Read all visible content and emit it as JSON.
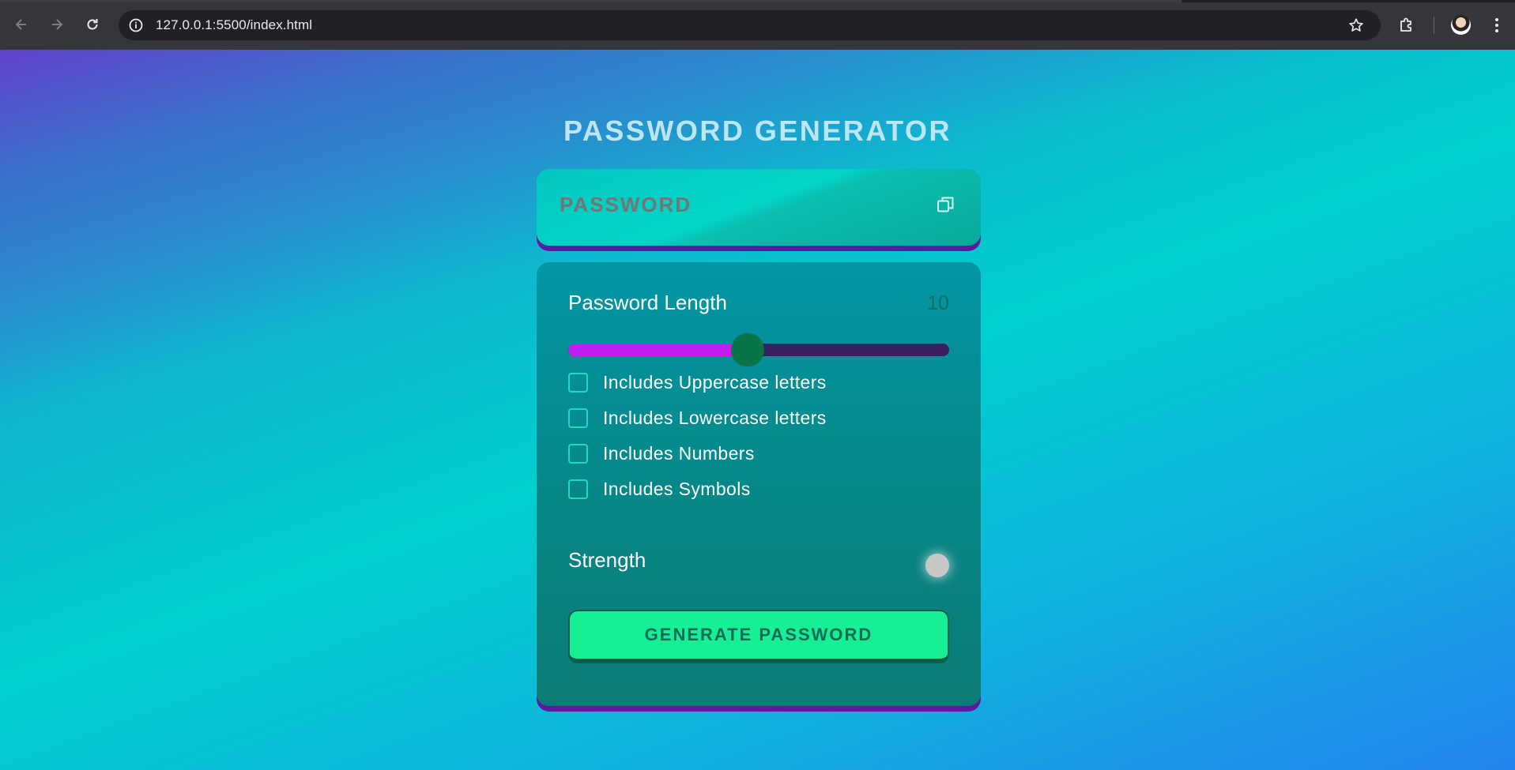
{
  "browser": {
    "url": "127.0.0.1:5500/index.html",
    "icons": {
      "back": "arrow-left-icon",
      "forward": "arrow-right-icon",
      "reload": "reload-icon",
      "site_info": "info-icon",
      "bookmark": "star-icon",
      "extensions": "puzzle-icon",
      "profile": "avatar",
      "menu": "kebab-menu-icon"
    }
  },
  "app": {
    "title": "PASSWORD GENERATOR",
    "password": {
      "placeholder": "PASSWORD",
      "value": "",
      "copy_icon": "copy-icon"
    },
    "length": {
      "label": "Password Length",
      "value": "10",
      "min": 1,
      "max": 20,
      "fill_fraction": 0.47
    },
    "options": [
      {
        "label": "Includes Uppercase letters",
        "checked": false
      },
      {
        "label": "Includes Lowercase letters",
        "checked": false
      },
      {
        "label": "Includes Numbers",
        "checked": false
      },
      {
        "label": "Includes Symbols",
        "checked": false
      }
    ],
    "strength": {
      "label": "Strength",
      "indicator_color": "#c8c8c8"
    },
    "generate_button": "GENERATE PASSWORD"
  },
  "colors": {
    "slider_fill": "#c01ff0",
    "slider_track": "#3a1f5e",
    "slider_thumb": "#087448",
    "button": "#16ef93",
    "panel_shadow": "#5b1aa0"
  }
}
